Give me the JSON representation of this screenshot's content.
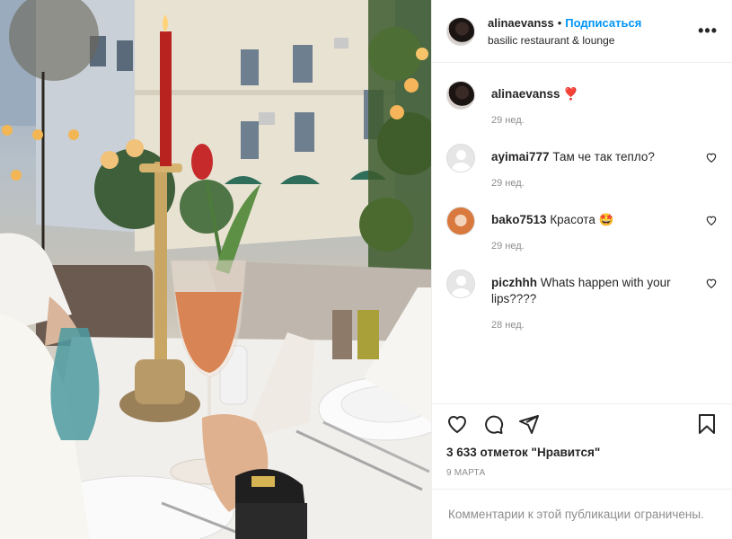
{
  "post": {
    "username": "alinaevanss",
    "follow_label": "Подписаться",
    "separator": "•",
    "location": "basilic restaurant & lounge",
    "more_label": "•••",
    "image": {
      "description": "Evening restaurant terrace: glass of rosé aperitif held by a hand, candle in candlestick, red tulip, white plates, street with lamps and building in background",
      "colors": {
        "sky": "#8ea0b6",
        "building": "#e8e2d3",
        "awning": "#2f6e5a",
        "candle": "#b8231f",
        "drink": "#d98454",
        "tablecloth": "#f1efec"
      }
    }
  },
  "caption": {
    "username": "alinaevanss",
    "emoji": "❣️",
    "time": "29 нед."
  },
  "comments": [
    {
      "username": "ayimai777",
      "text": "Там че так тепло?",
      "time": "29 нед."
    },
    {
      "username": "bako7513",
      "text": "Красота 🤩",
      "time": "29 нед."
    },
    {
      "username": "piczhhh",
      "text": "Whats happen with your lips????",
      "time": "28 нед."
    }
  ],
  "actions": {
    "like_icon": "heart-icon",
    "comment_icon": "comment-icon",
    "share_icon": "share-icon",
    "save_icon": "bookmark-icon"
  },
  "likes_text": "3 633 отметок \"Нравится\"",
  "date_text": "9 МАРТА",
  "comments_limited_text": "Комментарии к этой публикации ограничены."
}
